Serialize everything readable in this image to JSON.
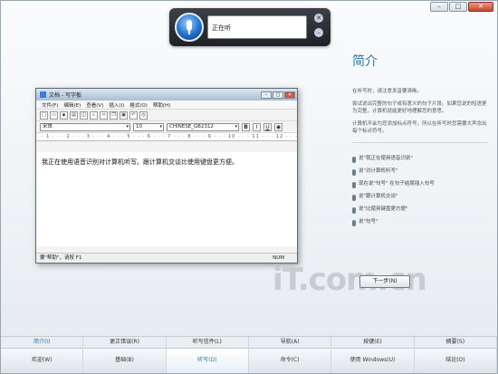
{
  "speech_bar": {
    "status": "正在听"
  },
  "right_panel": {
    "title": "简介",
    "paragraphs": [
      "在听写时，请注意发音要清晰。",
      "尝试说出完整的句子或有意义的句子片段。如果您说的短语更为完整，计算机就能更好地理解您的意思。",
      "计算机不会为您添加标点符号，所以在听写时您需要大声念出每个标点符号。"
    ],
    "say_items": [
      "说\"我正在使用语音识别\"",
      "说\"对计算机听写\"",
      "现在说\"句号\" 在句子结尾插入句号",
      "说\"跟计算机交谈\"",
      "说\"比使用键盘更方便\"",
      "说\"句号\""
    ],
    "next_button": "下一步(N)"
  },
  "wordpad": {
    "title": "文档 - 写字板",
    "menu": [
      "文件(F)",
      "编辑(E)",
      "查看(V)",
      "插入(I)",
      "格式(O)",
      "帮助(H)"
    ],
    "font": "宋体",
    "size": "10",
    "script": "CHINESE_GB2312",
    "bold": "B",
    "italic": "I",
    "underline": "U",
    "ruler": "· 1 · · · 2 · · · 3 · · · 4 · · · 5 · · · 6 · · · 7 · · · 8 · · · 9 · · · 10 · · · 11 · · · 12 · · · 13",
    "document_text": "我正在使用语音识别对计算机听写。跟计算机交谈比使用键盘更方便。",
    "status_help": "要\"帮助\"，请按 F1",
    "status_num": "NUM"
  },
  "watermark": "iT.com.cn",
  "nav_top": [
    "简介(I)",
    "更正错误(R)",
    "听写信件(L)",
    "导航(A)",
    "按键(E)",
    "摘要(S)"
  ],
  "nav_bottom": [
    "欢迎(W)",
    "基础(B)",
    "听写(D)",
    "命令(C)",
    "使用 Windows(U)",
    "结论(O)"
  ],
  "window_controls": [
    "–",
    "□",
    "✕"
  ]
}
